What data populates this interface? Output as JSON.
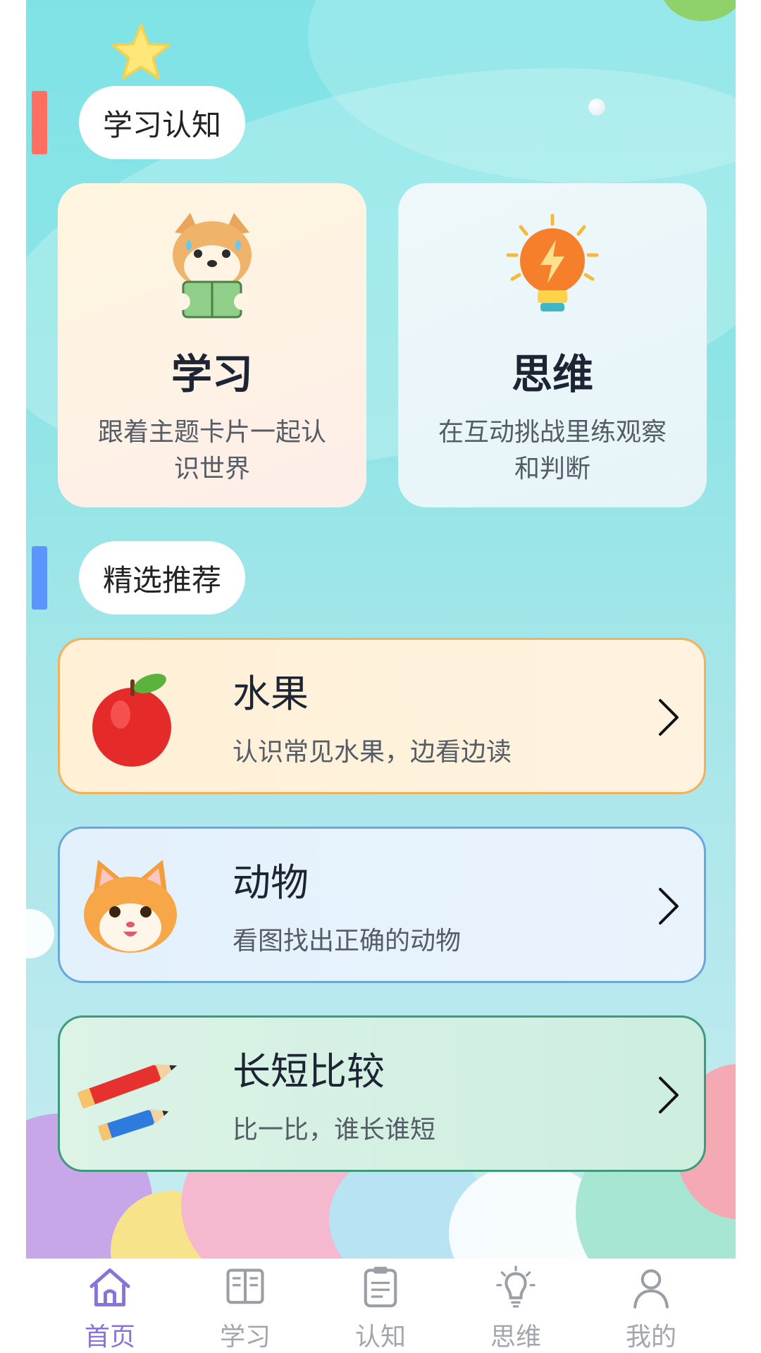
{
  "sections": {
    "learning": {
      "label": "学习认知",
      "bar_color": "#ff6f61"
    },
    "featured": {
      "label": "精选推荐",
      "bar_color": "#5b96ff"
    }
  },
  "big_cards": [
    {
      "title": "学习",
      "desc": "跟着主题卡片一起认识世界",
      "icon": "shiba-reading-icon"
    },
    {
      "title": "思维",
      "desc": "在互动挑战里练观察和判断",
      "icon": "lightbulb-icon"
    }
  ],
  "recommendations": [
    {
      "title": "水果",
      "desc": "认识常见水果，边看边读",
      "icon": "apple-icon",
      "border": "#f0b15a"
    },
    {
      "title": "动物",
      "desc": "看图找出正确的动物",
      "icon": "cat-icon",
      "border": "#6aa7dc"
    },
    {
      "title": "长短比较",
      "desc": "比一比，谁长谁短",
      "icon": "pencils-icon",
      "border": "#3f9a7b"
    }
  ],
  "tabbar": {
    "active": "首页",
    "accent": "#8a72d8",
    "items": [
      {
        "label": "首页",
        "icon": "home-icon"
      },
      {
        "label": "学习",
        "icon": "book-icon"
      },
      {
        "label": "认知",
        "icon": "clipboard-icon"
      },
      {
        "label": "思维",
        "icon": "lightbulb-icon"
      },
      {
        "label": "我的",
        "icon": "profile-icon"
      }
    ]
  }
}
